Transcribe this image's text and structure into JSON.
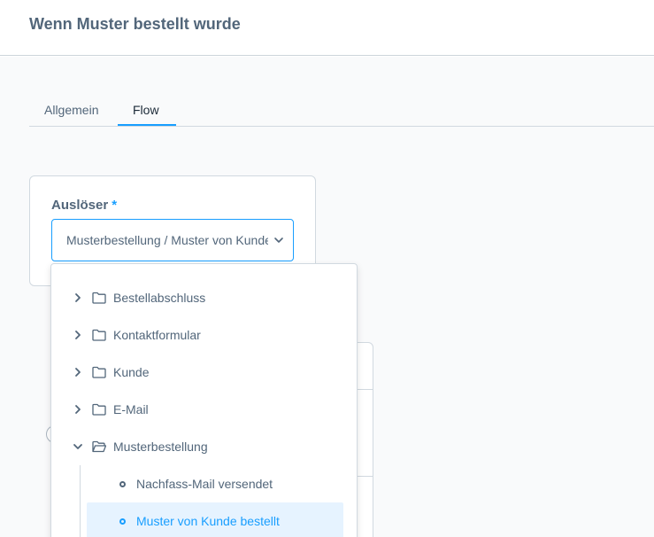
{
  "header": {
    "title": "Wenn Muster bestellt wurde"
  },
  "tabs": [
    {
      "label": "Allgemein"
    },
    {
      "label": "Flow"
    }
  ],
  "trigger": {
    "label": "Auslöser",
    "required_marker": "*",
    "value": "Musterbestellung / Muster von Kunde bestellt"
  },
  "tree": {
    "items": [
      {
        "label": "Bestellabschluss",
        "expanded": false
      },
      {
        "label": "Kontaktformular",
        "expanded": false
      },
      {
        "label": "Kunde",
        "expanded": false
      },
      {
        "label": "E-Mail",
        "expanded": false
      },
      {
        "label": "Musterbestellung",
        "expanded": true,
        "children": [
          {
            "label": "Nachfass-Mail versendet",
            "selected": false
          },
          {
            "label": "Muster von Kunde bestellt",
            "selected": true
          }
        ]
      }
    ]
  },
  "colors": {
    "accent": "#189eff",
    "text": "#52667a",
    "selected_bg": "#e6f3ff",
    "border": "#d1d9e0"
  },
  "icons": [
    "chevron-right-icon",
    "chevron-down-icon",
    "folder-icon",
    "folder-open-icon",
    "leaf-node-icon"
  ]
}
